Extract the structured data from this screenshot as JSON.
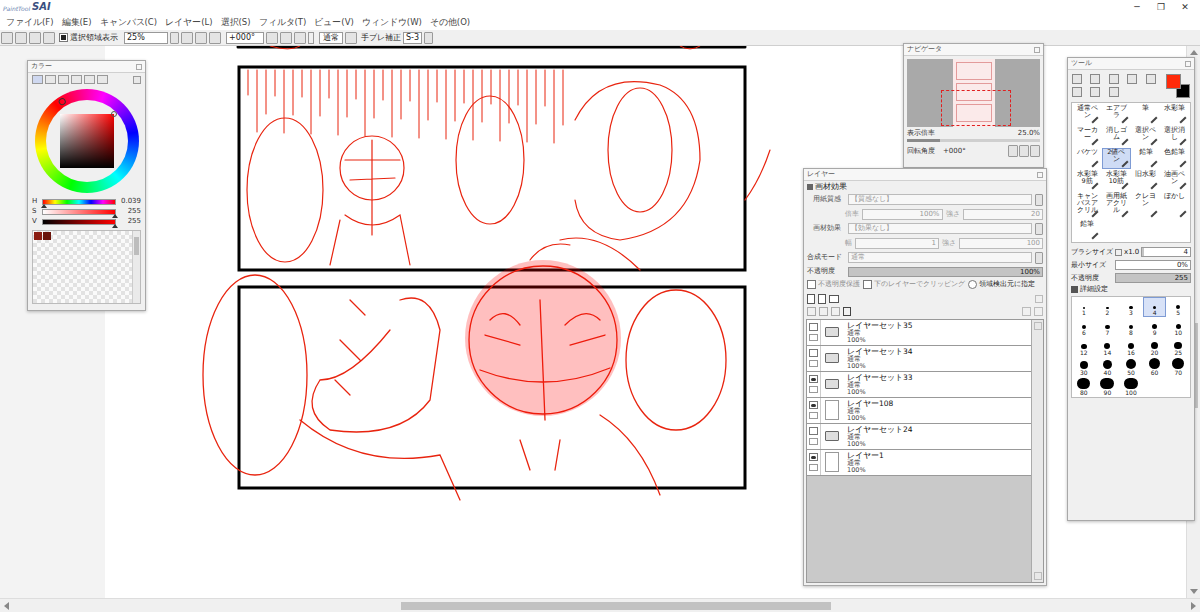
{
  "app": {
    "logo_small": "PaintTool",
    "logo": "SAI",
    "window_controls": [
      "─",
      "❐",
      "✕"
    ]
  },
  "menu": [
    "ファイル(F)",
    "編集(E)",
    "キャンバス(C)",
    "レイヤー(L)",
    "選択(S)",
    "フィルタ(T)",
    "ビュー(V)",
    "ウィンドウ(W)",
    "その他(O)"
  ],
  "toolbar": {
    "selection_display": {
      "label": "選択領域表示",
      "checked": true
    },
    "zoom": "25%",
    "angle": "+000°",
    "blend": "通常",
    "stabilizer_label": "手ブレ補正",
    "stabilizer": "S-3"
  },
  "color_panel": {
    "title": "カラー",
    "sliders": [
      {
        "label": "H",
        "reading": "0.039",
        "level": 0.02
      },
      {
        "label": "S",
        "reading": "255",
        "level": 1
      },
      {
        "label": "V",
        "reading": "255",
        "level": 1
      }
    ],
    "swatches": [
      {
        "color": "#8a1d12"
      },
      {
        "color": "#6a140b"
      }
    ]
  },
  "navigator": {
    "title": "ナビゲータ",
    "zoom_label": "表示倍率",
    "zoom": "25.0%",
    "zoom_level": 0.25,
    "angle_label": "回転角度",
    "angle": "+000°"
  },
  "layer_panel": {
    "title": "レイヤー",
    "section": "画材効果",
    "texture": {
      "label": "用紙質感",
      "value": "【質感なし】",
      "scale_label": "倍率",
      "scale": "100%",
      "strength_label": "強さ",
      "strength": "20"
    },
    "effect": {
      "label": "画材効果",
      "value": "【効果なし】",
      "width_label": "幅",
      "width": "1",
      "strength_label": "強さ",
      "strength": "100"
    },
    "blend": {
      "label": "合成モード",
      "value": "通常"
    },
    "opacity": {
      "label": "不透明度",
      "value": "100%",
      "level": 1
    },
    "options": [
      {
        "label": "不透明度保護",
        "checked": false,
        "kind": "checkbox",
        "disabled": true
      },
      {
        "label": "下のレイヤーでクリッピング",
        "checked": false,
        "kind": "checkbox",
        "disabled": true
      },
      {
        "label": "領域検出元に指定",
        "checked": false,
        "kind": "radio",
        "disabled": false
      }
    ],
    "layers": [
      {
        "name": "レイヤーセット35",
        "mode": "通常",
        "opacity": "100%",
        "visible": false,
        "kind": "set",
        "selected": false
      },
      {
        "name": "レイヤーセット34",
        "mode": "通常",
        "opacity": "100%",
        "visible": false,
        "kind": "set",
        "selected": false
      },
      {
        "name": "レイヤーセット33",
        "mode": "通常",
        "opacity": "100%",
        "visible": true,
        "kind": "set",
        "selected": false
      },
      {
        "name": "レイヤー108",
        "mode": "通常",
        "opacity": "100%",
        "visible": true,
        "kind": "layer",
        "selected": false
      },
      {
        "name": "レイヤーセット24",
        "mode": "通常",
        "opacity": "100%",
        "visible": false,
        "kind": "set",
        "selected": false
      },
      {
        "name": "レイヤー1",
        "mode": "通常",
        "opacity": "100%",
        "visible": true,
        "kind": "layer",
        "selected": false
      }
    ]
  },
  "tool_panel": {
    "title": "ツール",
    "colors": [
      {
        "name": "main",
        "color": "#ff2a0a"
      },
      {
        "name": "sub",
        "color": "#000000"
      }
    ],
    "tools": [
      {
        "label": "通常ペン",
        "selected": false
      },
      {
        "label": "エアブラ",
        "selected": false
      },
      {
        "label": "筆",
        "selected": false
      },
      {
        "label": "水彩筆",
        "selected": false
      },
      {
        "label": "マーカー",
        "selected": false
      },
      {
        "label": "消しゴム",
        "selected": false
      },
      {
        "label": "選択ペン",
        "selected": false
      },
      {
        "label": "選択消し",
        "selected": false
      },
      {
        "label": "バケツ",
        "selected": false
      },
      {
        "label": "2値ペン",
        "selected": true
      },
      {
        "label": "鉛筆",
        "selected": false
      },
      {
        "label": "色鉛筆",
        "selected": false
      },
      {
        "label": "水彩筆9筋",
        "selected": false
      },
      {
        "label": "水彩筆10筋",
        "selected": false
      },
      {
        "label": "旧水彩",
        "selected": false
      },
      {
        "label": "油画ペン",
        "selected": false
      },
      {
        "label": "キャンバスアクリル",
        "selected": false
      },
      {
        "label": "画用紙アクリル",
        "selected": false
      },
      {
        "label": "クレヨン",
        "selected": false
      },
      {
        "label": "ぼかし",
        "selected": false
      },
      {
        "label": "鉛筆",
        "selected": false
      }
    ],
    "brush_size": {
      "label": "ブラシサイズ",
      "multiplier": "x1.0",
      "value": "4",
      "level": 0.04
    },
    "min_size": {
      "label": "最小サイズ",
      "value": "0%",
      "level": 0
    },
    "opacity": {
      "label": "不透明度",
      "value": "255",
      "level": 1
    },
    "details": {
      "label": "詳細設定",
      "expanded": false
    },
    "sizes": [
      {
        "label": "1",
        "selected": false
      },
      {
        "label": "2",
        "selected": false
      },
      {
        "label": "3",
        "selected": false
      },
      {
        "label": "4",
        "selected": true
      },
      {
        "label": "5",
        "selected": false
      },
      {
        "label": "6",
        "selected": false
      },
      {
        "label": "7",
        "selected": false
      },
      {
        "label": "8",
        "selected": false
      },
      {
        "label": "9",
        "selected": false
      },
      {
        "label": "10",
        "selected": false
      },
      {
        "label": "12",
        "selected": false
      },
      {
        "label": "14",
        "selected": false
      },
      {
        "label": "16",
        "selected": false
      },
      {
        "label": "20",
        "selected": false
      },
      {
        "label": "25",
        "selected": false
      },
      {
        "label": "30",
        "selected": false
      },
      {
        "label": "40",
        "selected": false
      },
      {
        "label": "50",
        "selected": false
      },
      {
        "label": "60",
        "selected": false
      },
      {
        "label": "70",
        "selected": false
      },
      {
        "label": "80",
        "selected": false
      },
      {
        "label": "90",
        "selected": false
      },
      {
        "label": "100",
        "selected": false
      }
    ]
  }
}
